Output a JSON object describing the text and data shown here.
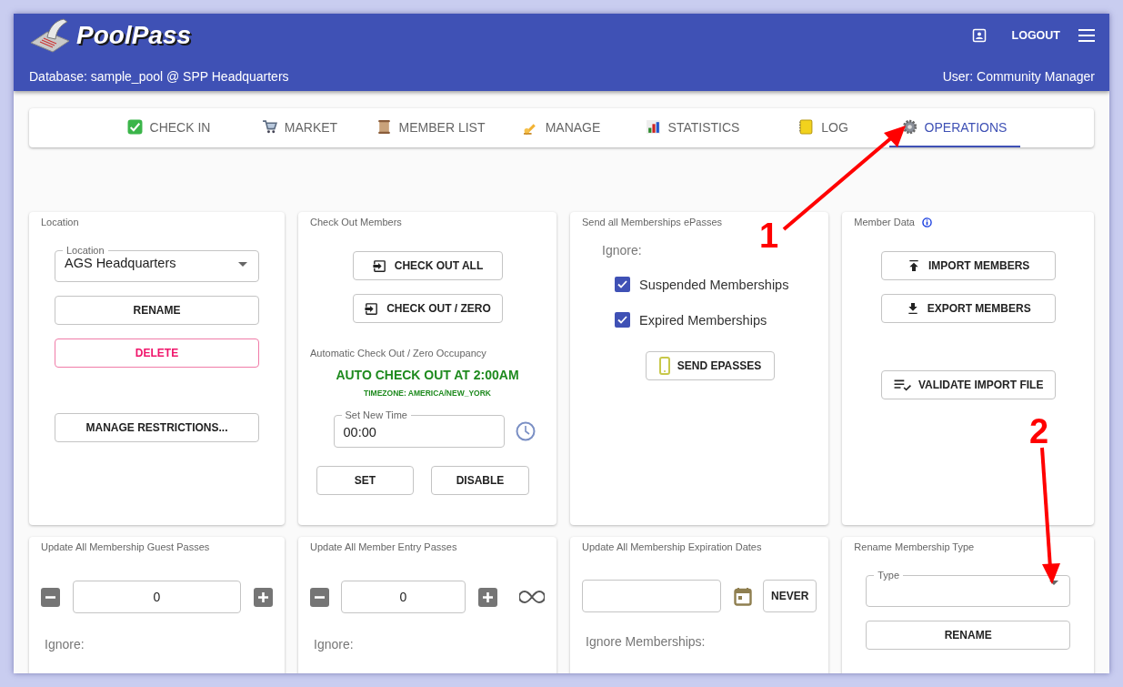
{
  "header": {
    "title": "PoolPass",
    "database": "Database: sample_pool @ SPP Headquarters",
    "logout": "LOGOUT",
    "user": "User: Community Manager"
  },
  "tabs": [
    {
      "label": "CHECK IN",
      "selected": false
    },
    {
      "label": "MARKET",
      "selected": false
    },
    {
      "label": "MEMBER LIST",
      "selected": false
    },
    {
      "label": "MANAGE",
      "selected": false
    },
    {
      "label": "STATISTICS",
      "selected": false
    },
    {
      "label": "LOG",
      "selected": false
    },
    {
      "label": "OPERATIONS",
      "selected": true
    }
  ],
  "cards": [
    {
      "kind": "location",
      "title": "Location",
      "select": {
        "label": "Location",
        "value": "AGS Headquarters"
      },
      "buttons": [
        {
          "label": "RENAME",
          "kind": "normal"
        },
        {
          "label": "DELETE",
          "kind": "danger"
        },
        {
          "label": "MANAGE RESTRICTIONS...",
          "kind": "normal"
        }
      ]
    },
    {
      "kind": "checkout",
      "title": "Check Out Members",
      "buttons": [
        "CHECK OUT ALL",
        "CHECK OUT / ZERO"
      ],
      "auto_title": "Automatic Check Out / Zero Occupancy",
      "status": "AUTO CHECK OUT AT 2:00AM",
      "timezone": "TIMEZONE: AMERICA/NEW_YORK",
      "time_field": {
        "label": "Set New Time",
        "value": "00:00"
      },
      "actions": [
        "SET",
        "DISABLE"
      ]
    },
    {
      "kind": "epasses",
      "title": "Send all Memberships ePasses",
      "ignore": "Ignore:",
      "checkboxes": [
        {
          "label": "Suspended Memberships",
          "checked": true
        },
        {
          "label": "Expired Memberships",
          "checked": true
        }
      ],
      "button": "SEND EPASSES"
    },
    {
      "kind": "member_data",
      "title": "Member Data",
      "buttons": [
        "IMPORT MEMBERS",
        "EXPORT MEMBERS",
        "VALIDATE IMPORT FILE"
      ]
    },
    {
      "kind": "counter",
      "title": "Update All Membership Guest Passes",
      "value": "0",
      "unlimited": false,
      "ignore": "Ignore:"
    },
    {
      "kind": "counter",
      "title": "Update All Member Entry Passes",
      "value": "0",
      "unlimited": true,
      "ignore": "Ignore:"
    },
    {
      "kind": "expiration",
      "title": "Update All Membership Expiration Dates",
      "button": "NEVER",
      "ignore": "Ignore Memberships:"
    },
    {
      "kind": "rename_type",
      "title": "Rename Membership Type",
      "select": {
        "label": "Type"
      },
      "button": "RENAME"
    }
  ],
  "annotations": [
    {
      "label": "1"
    },
    {
      "label": "2"
    }
  ]
}
